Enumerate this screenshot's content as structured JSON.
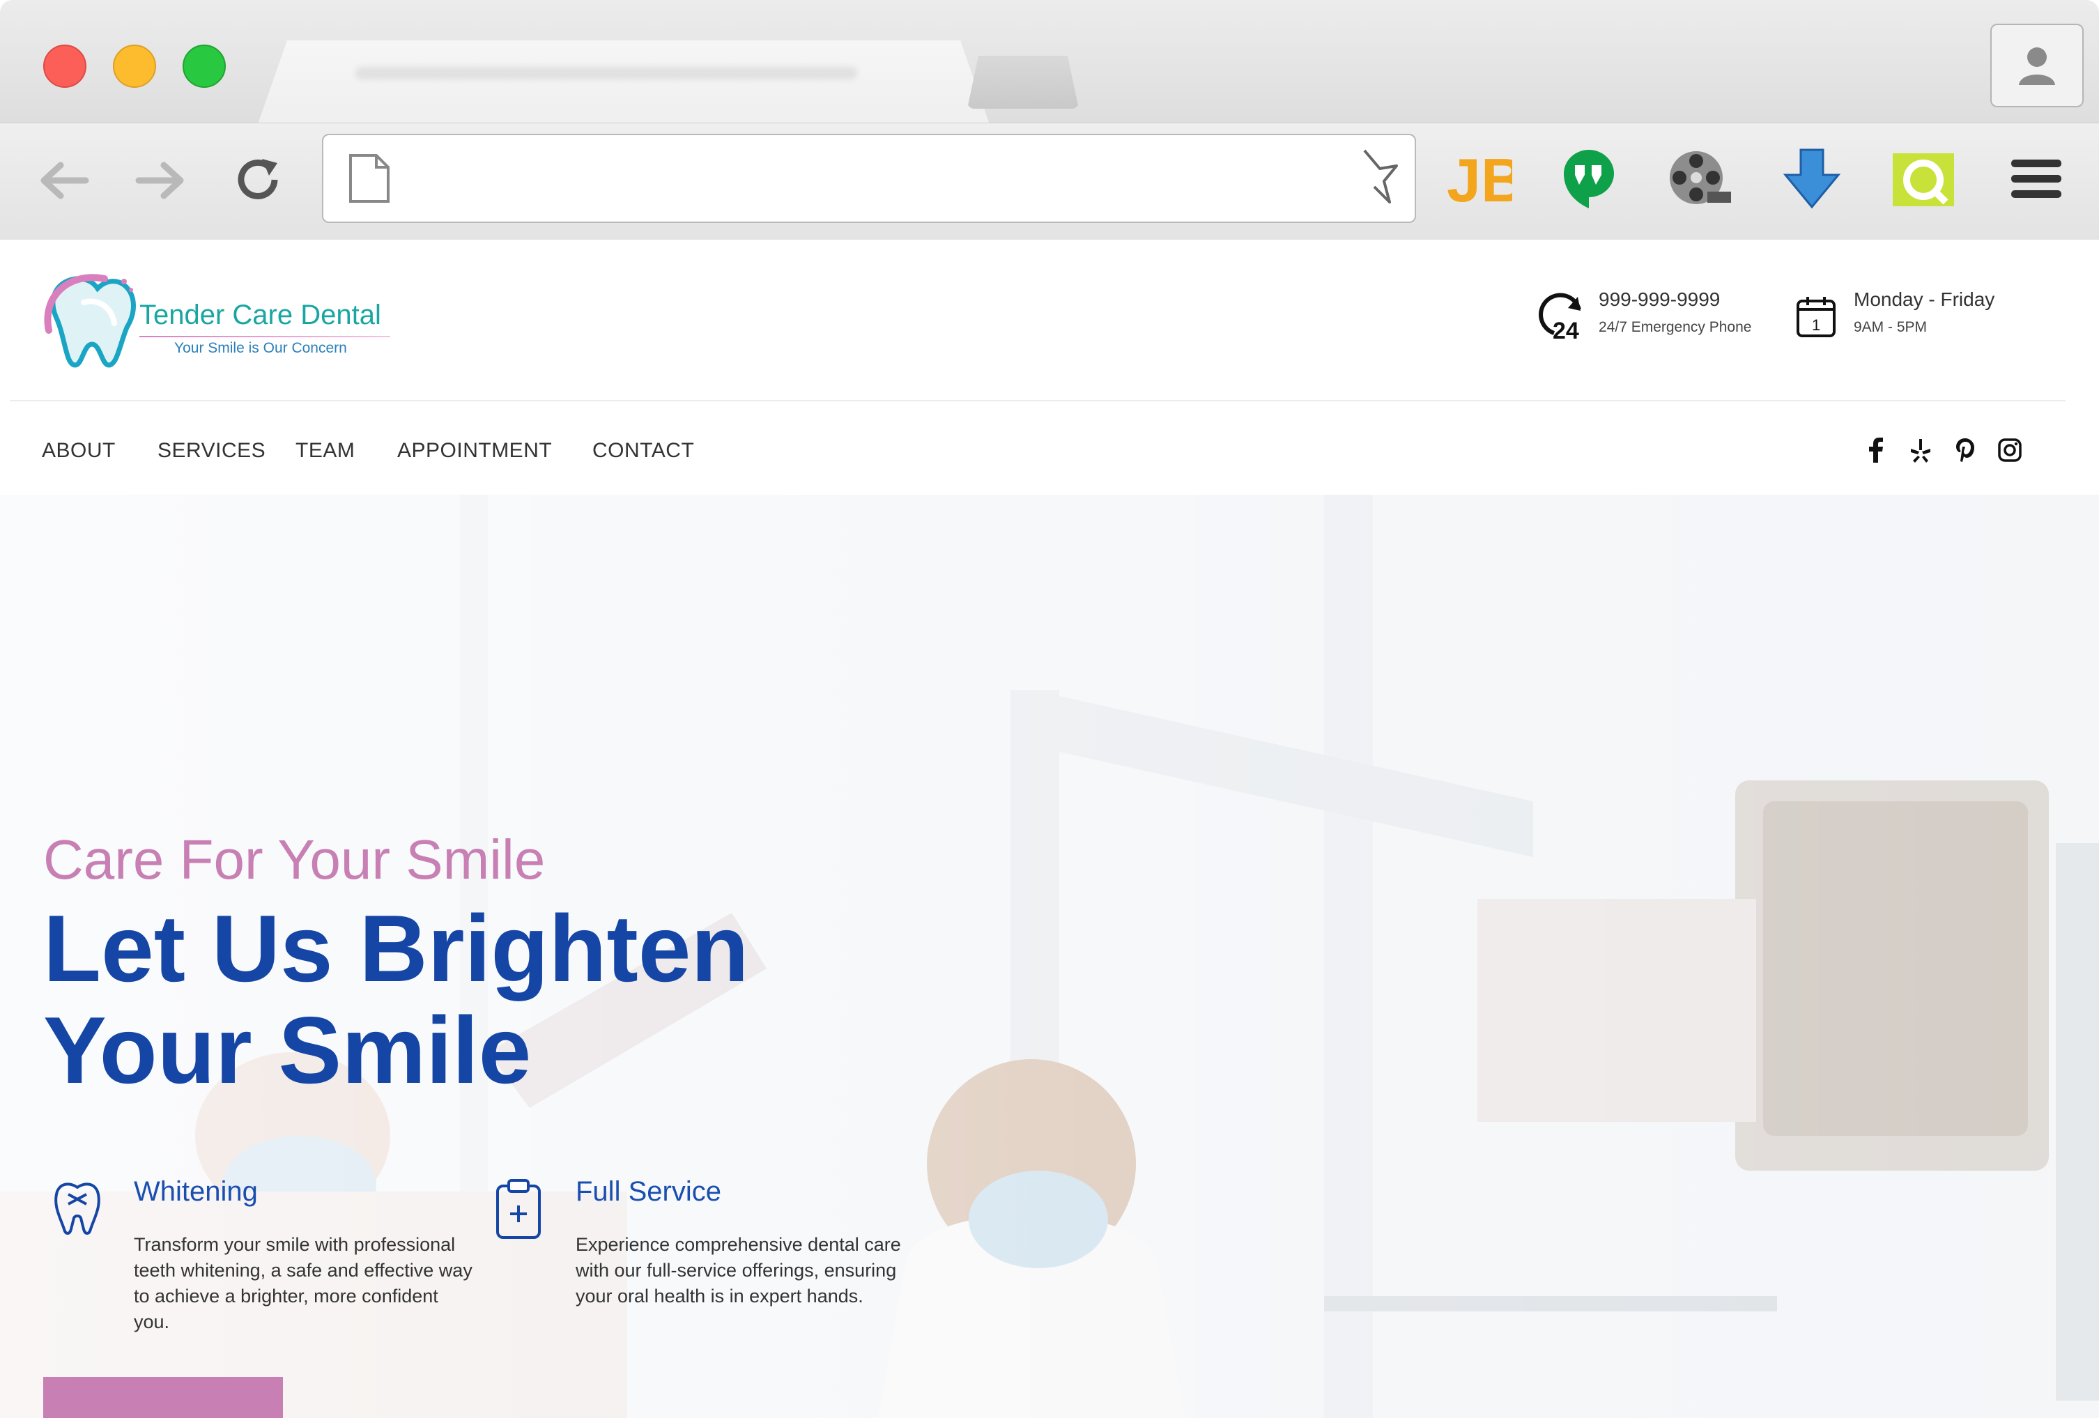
{
  "site": {
    "brand": {
      "name": "Tender Care Dental",
      "tagline": "Your Smile is Our Concern"
    },
    "contact": {
      "phone": "999-999-9999",
      "phone_sub": "24/7 Emergency Phone",
      "hours": "Monday - Friday",
      "hours_sub": "9AM - 5PM",
      "emergency_icon_text": "24",
      "calendar_icon_text": "1"
    },
    "nav": [
      "ABOUT",
      "SERVICES",
      "TEAM",
      "APPOINTMENT",
      "CONTACT"
    ],
    "social": [
      "facebook-icon",
      "yelp-icon",
      "pinterest-icon",
      "instagram-icon"
    ],
    "hero": {
      "kicker": "Care For Your Smile",
      "headline_1": "Let Us Brighten",
      "headline_2": "Your Smile",
      "features": [
        {
          "title": "Whitening",
          "desc": "Transform your smile with professional teeth whitening, a safe and effective way to achieve a brighter, more confident you.",
          "icon": "tooth-icon"
        },
        {
          "title": "Full Service",
          "desc": "Experience comprehensive dental care with our full-service offerings, ensuring your oral health is in expert hands.",
          "icon": "clipboard-plus-icon"
        }
      ]
    }
  },
  "browser": {
    "extensions": [
      "jb-extension-icon",
      "hangouts-icon",
      "film-reel-icon",
      "download-arrow-icon",
      "screenshot-tool-icon"
    ],
    "ext_jb_label": "JB",
    "colors": {
      "accent_pink": "#c77fb4",
      "accent_blue": "#1546a6",
      "brand_teal": "#19a6a3"
    }
  }
}
